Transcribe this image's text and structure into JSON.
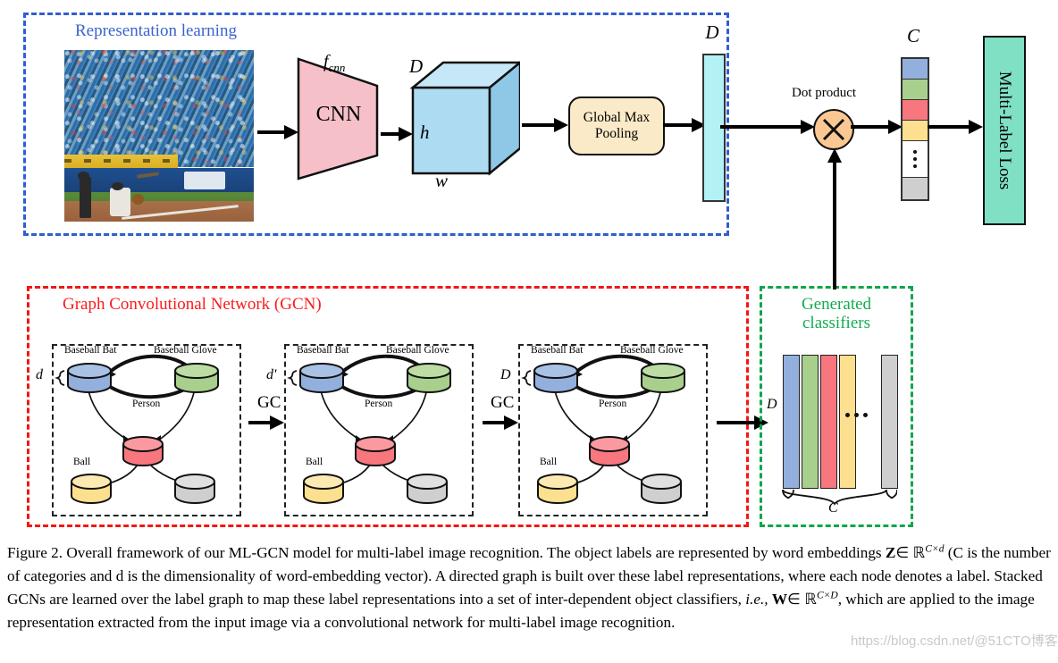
{
  "figure": {
    "regions": {
      "representation_learning": "Representation learning",
      "gcn": "Graph Convolutional Network (GCN)",
      "generated_classifiers_line1": "Generated",
      "generated_classifiers_line2": "classifiers"
    },
    "colors": {
      "region_blue": "#2e5fd0",
      "region_red": "#f41616",
      "region_green": "#0aa64a",
      "cnn_fill": "#f6c0c8",
      "cube_fill": "#a9d9f0",
      "gmp_fill": "#fbeac8",
      "dbar_fill": "#b2f1f6",
      "dot_fill": "#fbc894",
      "loss_fill": "#7fe0c4",
      "node_blue": "#93afdd",
      "node_green": "#a9cf8c",
      "node_red": "#f8767e",
      "node_yellow": "#fce08f",
      "node_gray": "#cfcfcf"
    },
    "pipeline": {
      "cnn_label": "CNN",
      "cnn_function": "f",
      "cnn_function_sub": "cnn",
      "cube_depth_label": "D",
      "cube_height_label": "h",
      "cube_width_label": "w",
      "pooling_line1": "Global Max",
      "pooling_line2": "Pooling",
      "feature_dim_label": "D",
      "dot_product_label": "Dot product",
      "dot_product_glyph": "×",
      "score_vector_label": "C",
      "loss_label": "Multi-Label Loss"
    },
    "score_vector": [
      {
        "color": "#93afdd"
      },
      {
        "color": "#a9cf8c"
      },
      {
        "color": "#f8767e"
      },
      {
        "color": "#fce08f"
      },
      {
        "color": "#ffffff",
        "dots": true
      },
      {
        "color": "#cfcfcf"
      }
    ],
    "gcn": {
      "panels": [
        {
          "dim_label": "d",
          "nodes": [
            "Baseball Bat",
            "Baseball Glove",
            "Person",
            "Ball"
          ]
        },
        {
          "dim_label": "d′",
          "nodes": [
            "Baseball Bat",
            "Baseball Glove",
            "Person",
            "Ball"
          ]
        },
        {
          "dim_label": "D",
          "nodes": [
            "Baseball Bat",
            "Baseball Glove",
            "Person",
            "Ball"
          ]
        }
      ],
      "gc_label": "GC",
      "output_dim_label": "C"
    },
    "classifiers": {
      "row_dim_label": "D",
      "count_label": "C",
      "bars": [
        "#93afdd",
        "#a9cf8c",
        "#f8767e",
        "#fce08f",
        "#cfcfcf"
      ]
    },
    "caption": {
      "p1": "Figure 2. Overall framework of our ML-GCN model for multi-label image recognition. The object labels are represented by word embeddings",
      "z_symbol": "Z",
      "z_rel": "∈ ℝ",
      "z_sup": "C×d",
      "p2": "(C is the number of categories and d is the dimensionality of word-embedding vector). A directed graph is built over these label representations, where each node denotes a label. Stacked GCNs are learned over the label graph to map these label representations into a set of inter-dependent object classifiers,",
      "ie": "i.e.,",
      "w_symbol": "W",
      "w_rel": "∈ ℝ",
      "w_sup": "C×D",
      "p3": ", which are applied to the image representation extracted from the input image via a convolutional network for multi-label image recognition."
    },
    "watermark": "https://blog.csdn.net/@51CTO博客"
  }
}
